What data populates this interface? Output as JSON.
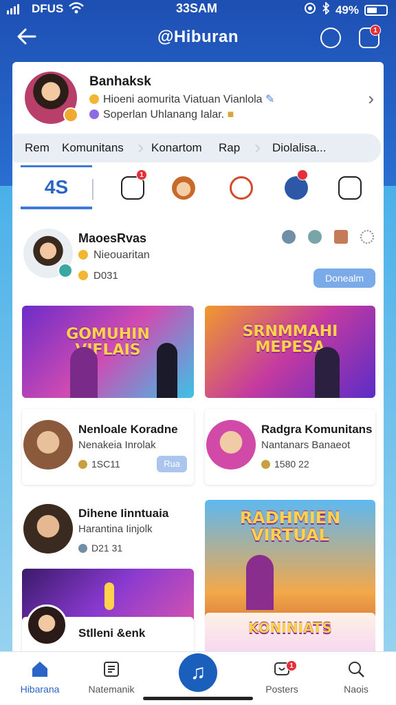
{
  "status_bar": {
    "carrier": "DFUS",
    "time": "33SAM",
    "battery": "49%"
  },
  "header": {
    "title": "@Hiburan",
    "notif_badge": "1"
  },
  "profile": {
    "name": "Banhaksk",
    "line1": "Hioeni aomurita Viatuan Vianlola",
    "line2": "Soperlan Uhlanang Ialar."
  },
  "breadcrumbs": [
    "Rem",
    "Komunitans",
    "Konartom",
    "Rap",
    "Diolalisa..."
  ],
  "tabs": {
    "active_label": "4S",
    "badge": "1"
  },
  "creator": {
    "name": "MaoesRvas",
    "subtitle": "Nieouaritan",
    "count": "D031",
    "button": "Donealm"
  },
  "banners": {
    "left_title": "GOMUHIN\nVIFLAIS",
    "right_title": "SRNMMAHI\nMEPESA",
    "tall_title": "RADHMIEN\nVIRTUAL",
    "bottom_title": "KONINIATS"
  },
  "cards": [
    {
      "name": "Nenloale Koradne",
      "sub": "Nenakeia Inrolak",
      "num": "1SC11",
      "button": "Rua"
    },
    {
      "name": "Radgra Komunitans",
      "sub": "Nantanars Banaeot",
      "num": "1580 22"
    },
    {
      "name": "Dihene Iinntuaia",
      "sub": "Harantina Iinjolk",
      "num": "D21 31"
    },
    {
      "name": "Stlleni &enk"
    }
  ],
  "bottom_nav": [
    {
      "label": "Hibarana"
    },
    {
      "label": "Natemanik"
    },
    {
      "label": "Posters",
      "badge": "1"
    },
    {
      "label": "Naois"
    }
  ],
  "colors": {
    "accent": "#2b64c7",
    "header": "#1e4fb3",
    "badge": "#e5303a"
  }
}
